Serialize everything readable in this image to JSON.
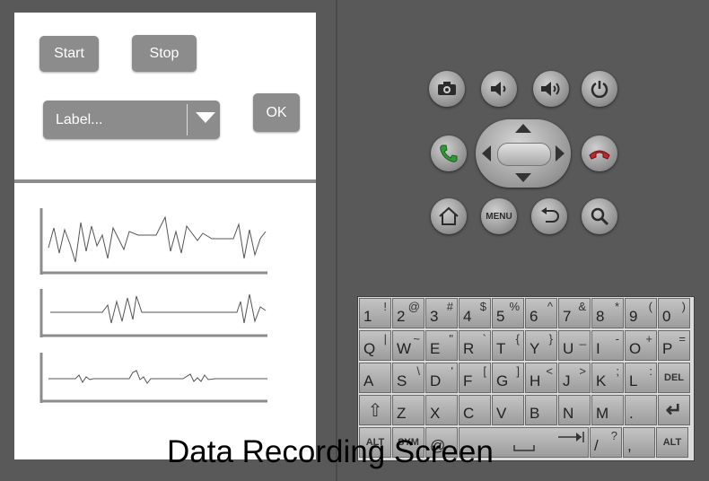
{
  "app": {
    "start_label": "Start",
    "stop_label": "Stop",
    "spinner_value": "Label...",
    "ok_label": "OK"
  },
  "caption": "Data Recording Screen",
  "device_keys": {
    "menu_label": "MENU"
  },
  "keyboard": {
    "row1": [
      {
        "main": "1",
        "alt": "!"
      },
      {
        "main": "2",
        "alt": "@"
      },
      {
        "main": "3",
        "alt": "#"
      },
      {
        "main": "4",
        "alt": "$"
      },
      {
        "main": "5",
        "alt": "%"
      },
      {
        "main": "6",
        "alt": "^"
      },
      {
        "main": "7",
        "alt": "&"
      },
      {
        "main": "8",
        "alt": "*"
      },
      {
        "main": "9",
        "alt": "("
      },
      {
        "main": "0",
        "alt": ")"
      }
    ],
    "row2": [
      {
        "main": "Q",
        "alt": "|"
      },
      {
        "main": "W",
        "alt": "~"
      },
      {
        "main": "E",
        "alt": "\""
      },
      {
        "main": "R",
        "alt": "`"
      },
      {
        "main": "T",
        "alt": "{"
      },
      {
        "main": "Y",
        "alt": "}"
      },
      {
        "main": "U",
        "alt": "_"
      },
      {
        "main": "I",
        "alt": "-"
      },
      {
        "main": "O",
        "alt": "+"
      },
      {
        "main": "P",
        "alt": "="
      }
    ],
    "row3": [
      {
        "main": "A",
        "alt": ""
      },
      {
        "main": "S",
        "alt": "\\"
      },
      {
        "main": "D",
        "alt": "'"
      },
      {
        "main": "F",
        "alt": "["
      },
      {
        "main": "G",
        "alt": "]"
      },
      {
        "main": "H",
        "alt": "<"
      },
      {
        "main": "J",
        "alt": ">"
      },
      {
        "main": "K",
        "alt": ";"
      },
      {
        "main": "L",
        "alt": ":"
      },
      {
        "main": "",
        "alt": "",
        "special": "DEL"
      }
    ],
    "row4": [
      {
        "main": "",
        "alt": "",
        "special": "⇧"
      },
      {
        "main": "Z",
        "alt": ""
      },
      {
        "main": "X",
        "alt": ""
      },
      {
        "main": "C",
        "alt": ""
      },
      {
        "main": "V",
        "alt": ""
      },
      {
        "main": "B",
        "alt": ""
      },
      {
        "main": "N",
        "alt": ""
      },
      {
        "main": "M",
        "alt": ""
      },
      {
        "main": ".",
        "alt": ""
      },
      {
        "main": "",
        "alt": "",
        "special": "↵"
      }
    ],
    "row5_left": [
      {
        "main": "",
        "alt": "",
        "special": "ALT"
      },
      {
        "main": "",
        "alt": "",
        "special": "SYM"
      },
      {
        "main": "@",
        "alt": ""
      }
    ],
    "row5_right": [
      {
        "main": "/",
        "alt": "?"
      },
      {
        "main": ",",
        "alt": ""
      },
      {
        "main": "",
        "alt": "",
        "special": "ALT"
      }
    ]
  },
  "colors": {
    "button_gray": "#8c8c8c",
    "call_green": "#2f9a3a",
    "end_red": "#c0262b"
  }
}
